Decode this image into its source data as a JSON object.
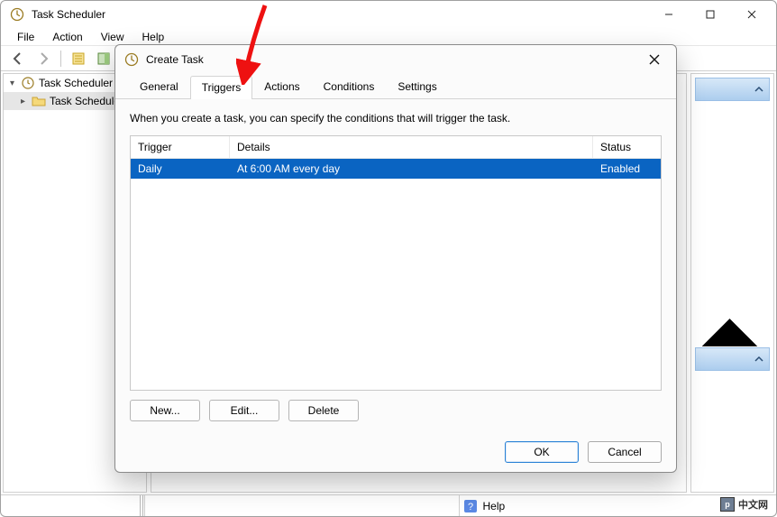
{
  "main_window": {
    "title": "Task Scheduler",
    "menubar": [
      "File",
      "Action",
      "View",
      "Help"
    ],
    "tree": {
      "root": "Task Scheduler (L",
      "child": "Task Schedule"
    },
    "statusbar": {
      "help": "Help"
    }
  },
  "dialog": {
    "title": "Create Task",
    "tabs": [
      "General",
      "Triggers",
      "Actions",
      "Conditions",
      "Settings"
    ],
    "active_tab_index": 1,
    "description": "When you create a task, you can specify the conditions that will trigger the task.",
    "columns": {
      "trigger": "Trigger",
      "details": "Details",
      "status": "Status"
    },
    "rows": [
      {
        "trigger": "Daily",
        "details": "At 6:00 AM every day",
        "status": "Enabled"
      }
    ],
    "buttons": {
      "new": "New...",
      "edit": "Edit...",
      "delete": "Delete"
    },
    "footer": {
      "ok": "OK",
      "cancel": "Cancel"
    }
  },
  "logo": "中文网"
}
